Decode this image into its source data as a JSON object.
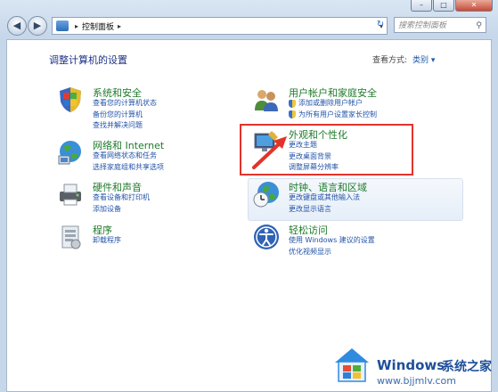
{
  "window": {
    "controls": {
      "minimize": "–",
      "maximize": "□",
      "close": "✕"
    }
  },
  "address_bar": {
    "path": [
      "控制面板"
    ],
    "search_placeholder": "搜索控制面板"
  },
  "main": {
    "heading": "调整计算机的设置",
    "view_by_label": "查看方式:",
    "view_by_value": "类别 ▾"
  },
  "categories": {
    "system": {
      "title": "系统和安全",
      "links": [
        "查看您的计算机状态",
        "备份您的计算机",
        "查找并解决问题"
      ]
    },
    "network": {
      "title": "网络和 Internet",
      "links": [
        "查看网络状态和任务",
        "选择家庭组和共享选项"
      ]
    },
    "hardware": {
      "title": "硬件和声音",
      "links": [
        "查看设备和打印机",
        "添加设备"
      ]
    },
    "programs": {
      "title": "程序",
      "links": [
        "卸载程序"
      ]
    },
    "users": {
      "title": "用户帐户和家庭安全",
      "links": [
        "添加或删除用户帐户",
        "为所有用户设置家长控制"
      ]
    },
    "appearance": {
      "title": "外观和个性化",
      "links": [
        "更改主题",
        "更改桌面背景",
        "调整屏幕分辨率"
      ]
    },
    "clock": {
      "title": "时钟、语言和区域",
      "links": [
        "更改键盘或其他输入法",
        "更改显示语言"
      ]
    },
    "ease": {
      "title": "轻松访问",
      "links": [
        "使用 Windows 建议的设置",
        "优化视频显示"
      ]
    }
  },
  "watermark": {
    "brand": "Windows",
    "site_name": "系统之家",
    "url": "www.bjjmlv.com"
  }
}
